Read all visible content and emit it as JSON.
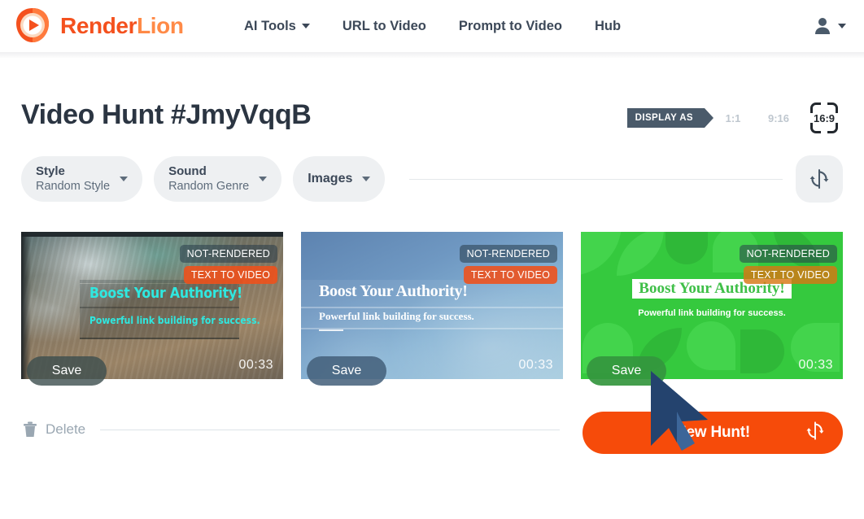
{
  "brand": {
    "name_part1": "Render",
    "name_part2": "Lion",
    "logo_icon": "lion-play-logo",
    "accent_orange": "#F4511E",
    "accent_orange_light": "#FF8A47"
  },
  "header": {
    "nav": [
      {
        "label": "AI Tools",
        "has_dropdown": true
      },
      {
        "label": "URL to Video",
        "has_dropdown": false
      },
      {
        "label": "Prompt to Video",
        "has_dropdown": false
      },
      {
        "label": "Hub",
        "has_dropdown": false
      }
    ],
    "account_icon": "user-account-icon",
    "account_caret_icon": "chevron-down-icon"
  },
  "page": {
    "title": "Video Hunt #JmyVqqB"
  },
  "display_as": {
    "tag_label": "DISPLAY AS",
    "options": [
      {
        "label": "1:1",
        "selected": false
      },
      {
        "label": "9:16",
        "selected": false
      },
      {
        "label": "16:9",
        "selected": true
      }
    ],
    "selected_value": "16:9"
  },
  "filters": {
    "style": {
      "label": "Style",
      "value": "Random Style",
      "caret_icon": "chevron-down-icon"
    },
    "sound": {
      "label": "Sound",
      "value": "Random Genre",
      "caret_icon": "chevron-down-icon"
    },
    "images": {
      "label": "Images",
      "caret_icon": "chevron-down-icon"
    },
    "refresh_icon": "refresh-sync-icon"
  },
  "videos": [
    {
      "status_badge": "NOT-RENDERED",
      "type_badge": "TEXT TO VIDEO",
      "headline": "Boost Your Authority!",
      "subline": "Powerful link building for success.",
      "save_label": "Save",
      "duration": "00:33",
      "theme": "aerial-terrain-cyan"
    },
    {
      "status_badge": "NOT-RENDERED",
      "type_badge": "TEXT TO VIDEO",
      "headline": "Boost Your Authority!",
      "subline": "Powerful link building for success.",
      "save_label": "Save",
      "duration": "00:33",
      "theme": "blue-gradient-serif"
    },
    {
      "status_badge": "NOT-RENDERED",
      "type_badge": "TEXT TO VIDEO",
      "headline": "Boost Your Authority!",
      "subline": "Powerful link building for success.",
      "save_label": "Save",
      "duration": "00:33",
      "theme": "green-shapes-serif"
    }
  ],
  "footer": {
    "delete_label": "Delete",
    "delete_icon": "trash-icon",
    "new_hunt_label": "New Hunt!",
    "new_hunt_icon": "refresh-sync-icon",
    "new_hunt_color": "#F64B0A"
  },
  "cursor": {
    "icon": "arrow-pointer-cursor"
  }
}
